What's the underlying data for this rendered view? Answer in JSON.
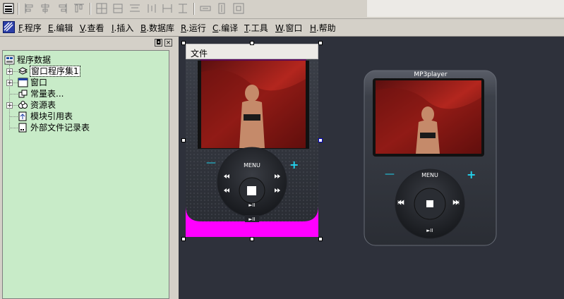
{
  "align_toolbar": {
    "buttons": [
      {
        "icon": "properties-icon"
      },
      {
        "icon": "align-left-icon"
      },
      {
        "icon": "align-center-horizontal-icon"
      },
      {
        "icon": "align-right-icon"
      },
      {
        "icon": "align-top-icon"
      },
      {
        "icon": "align-middle-icon"
      },
      {
        "icon": "align-bottom-icon"
      },
      {
        "icon": "same-width-icon"
      },
      {
        "icon": "same-height-icon"
      },
      {
        "icon": "same-size-icon"
      },
      {
        "icon": "space-horizontal-icon"
      },
      {
        "icon": "space-vertical-icon"
      },
      {
        "icon": "center-in-window-icon"
      }
    ]
  },
  "menubar": {
    "items": [
      {
        "key": "F",
        "label": ".程序"
      },
      {
        "key": "E",
        "label": ".编辑"
      },
      {
        "key": "V",
        "label": ".查看"
      },
      {
        "key": "I",
        "label": ".插入"
      },
      {
        "key": "B",
        "label": ".数据库"
      },
      {
        "key": "R",
        "label": ".运行"
      },
      {
        "key": "C",
        "label": ".编译"
      },
      {
        "key": "T",
        "label": ".工具"
      },
      {
        "key": "W",
        "label": ".窗口"
      },
      {
        "key": "H",
        "label": ".帮助"
      }
    ]
  },
  "panel": {
    "restore_glyph": "◘",
    "close_glyph": "×",
    "tree": {
      "root": "程序数据",
      "items": [
        {
          "label": "窗口程序集1",
          "icon": "class-module-icon",
          "expandable": true,
          "selected": true
        },
        {
          "label": "窗口",
          "icon": "window-icon",
          "expandable": true,
          "selected": false
        },
        {
          "label": "常量表...",
          "icon": "constants-icon",
          "expandable": false,
          "selected": false
        },
        {
          "label": "资源表",
          "icon": "resources-icon",
          "expandable": true,
          "selected": false
        },
        {
          "label": "模块引用表",
          "icon": "module-reference-icon",
          "expandable": false,
          "selected": false
        },
        {
          "label": "外部文件记录表",
          "icon": "external-file-icon",
          "expandable": false,
          "selected": false
        }
      ]
    }
  },
  "designer": {
    "form_title": "文件",
    "player": {
      "brand": "MP3player",
      "menu_label": "MENU",
      "minus": "—",
      "plus": "+",
      "play_pause": "►II"
    }
  },
  "colors": {
    "canvas": "#2e313b",
    "tree_bg": "#c8ebc8",
    "form_bg": "#ff00ff",
    "accent_cyan": "#22d3ee"
  }
}
